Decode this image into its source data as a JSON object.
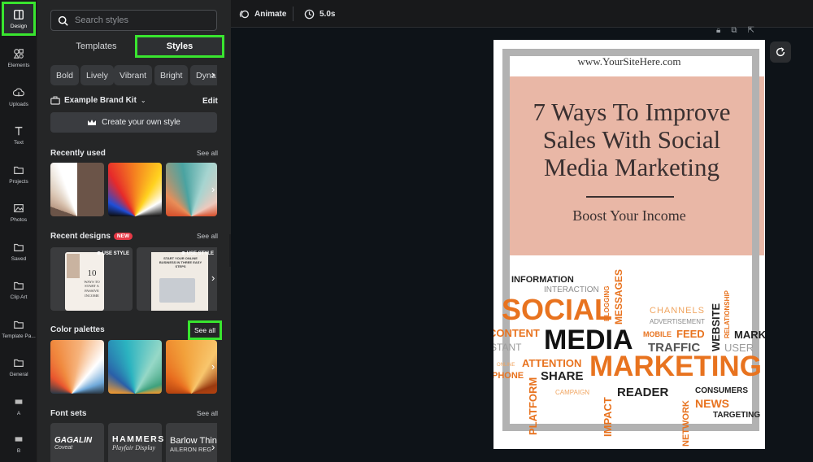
{
  "rail": {
    "items": [
      {
        "label": "Design",
        "icon": "design-icon"
      },
      {
        "label": "Elements",
        "icon": "elements-icon"
      },
      {
        "label": "Uploads",
        "icon": "uploads-icon"
      },
      {
        "label": "Text",
        "icon": "text-icon"
      },
      {
        "label": "Projects",
        "icon": "folder-icon"
      },
      {
        "label": "Photos",
        "icon": "photos-icon"
      },
      {
        "label": "Saved",
        "icon": "folder-icon"
      },
      {
        "label": "Clip Art",
        "icon": "folder-icon"
      },
      {
        "label": "Template Pa...",
        "icon": "folder-icon"
      },
      {
        "label": "General",
        "icon": "folder-icon"
      },
      {
        "label": "A",
        "icon": "folder-icon"
      },
      {
        "label": "B",
        "icon": "folder-icon"
      }
    ]
  },
  "panel": {
    "search_placeholder": "Search styles",
    "tabs": {
      "templates": "Templates",
      "styles": "Styles"
    },
    "chips": [
      "Bold",
      "Lively",
      "Vibrant",
      "Bright",
      "Dyna"
    ],
    "brand_kit": "Example Brand Kit",
    "edit": "Edit",
    "create_style": "Create your own style",
    "recently_used": "Recently used",
    "recent_designs": "Recent designs",
    "new_badge": "NEW",
    "use_style": "USE STYLE",
    "color_palettes": "Color palettes",
    "font_sets": "Font sets",
    "see_all": "See all",
    "design_thumb_1": [
      "10",
      "WAYS TO",
      "START A",
      "PASSIVE",
      "INCOME"
    ],
    "design_thumb_2": "START YOUR ONLINE BUSINESS IN THREE EASY STEPS",
    "font_samples": [
      {
        "line1": "GAGALIN",
        "line2": "Coveat"
      },
      {
        "line1": "HAMMERS",
        "line2": "Playfair Display"
      },
      {
        "line1": "Barlow Thin",
        "line2": "AILERON REG"
      }
    ]
  },
  "topbar": {
    "animate": "Animate",
    "duration": "5.0s"
  },
  "design": {
    "site": "www.YourSiteHere.com",
    "headline_lines": [
      "7 Ways To Improve",
      "Sales With Social",
      "Media Marketing"
    ],
    "subhead": "Boost Your Income",
    "words": [
      "INFORMATION",
      "INTERACTION",
      "BLOGGING",
      "MESSAGES",
      "SOCIAL",
      "CHANNELS",
      "ADVERTISEMENT",
      "WEBSITE",
      "RELATIONSHIP",
      "CONTENT",
      "MEDIA",
      "MOBILE",
      "FEED",
      "MARK",
      "TRAFFIC",
      "USER",
      "STANT",
      "ONLINE",
      "ATTENTION",
      "PHONE",
      "SHARE",
      "MARKETING",
      "PLATFORM",
      "CAMPAIGN",
      "IMPACT",
      "READER",
      "NETWORK",
      "CONSUMERS",
      "NEWS",
      "TARGETING"
    ]
  },
  "colors": {
    "highlight": "#39e52f",
    "accent_orange": "#e8731f",
    "pink_band": "#e9b7a6"
  }
}
